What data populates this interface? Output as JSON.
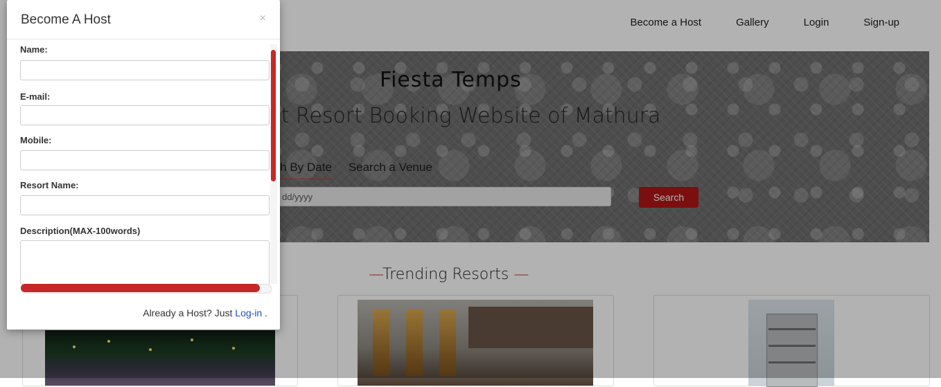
{
  "navbar": {
    "links": [
      "Become a Host",
      "Gallery",
      "Login",
      "Sign-up"
    ]
  },
  "hero": {
    "title": "Fiesta Temps",
    "subtitle": "st Resort Booking Website of Mathura",
    "tabs": [
      "rch By Date",
      "Search a Venue"
    ],
    "date_placeholder": "dd/yyyy",
    "search_label": "Search"
  },
  "trending": {
    "dash_left": "—",
    "label": "Trending Resorts",
    "dash_right": " —"
  },
  "modal": {
    "title": "Become A Host",
    "close_symbol": "×",
    "fields": {
      "name_label": "Name:",
      "email_label": "E-mail:",
      "mobile_label": "Mobile:",
      "resort_label": "Resort Name:",
      "description_label": "Description(MAX-100words)"
    },
    "footer_text": "Already a Host? Just ",
    "footer_link": "Log-in",
    "footer_end": " ."
  },
  "colors": {
    "accent": "#b01616",
    "link": "#1a4fc4",
    "scrollbar": "#c62828"
  }
}
